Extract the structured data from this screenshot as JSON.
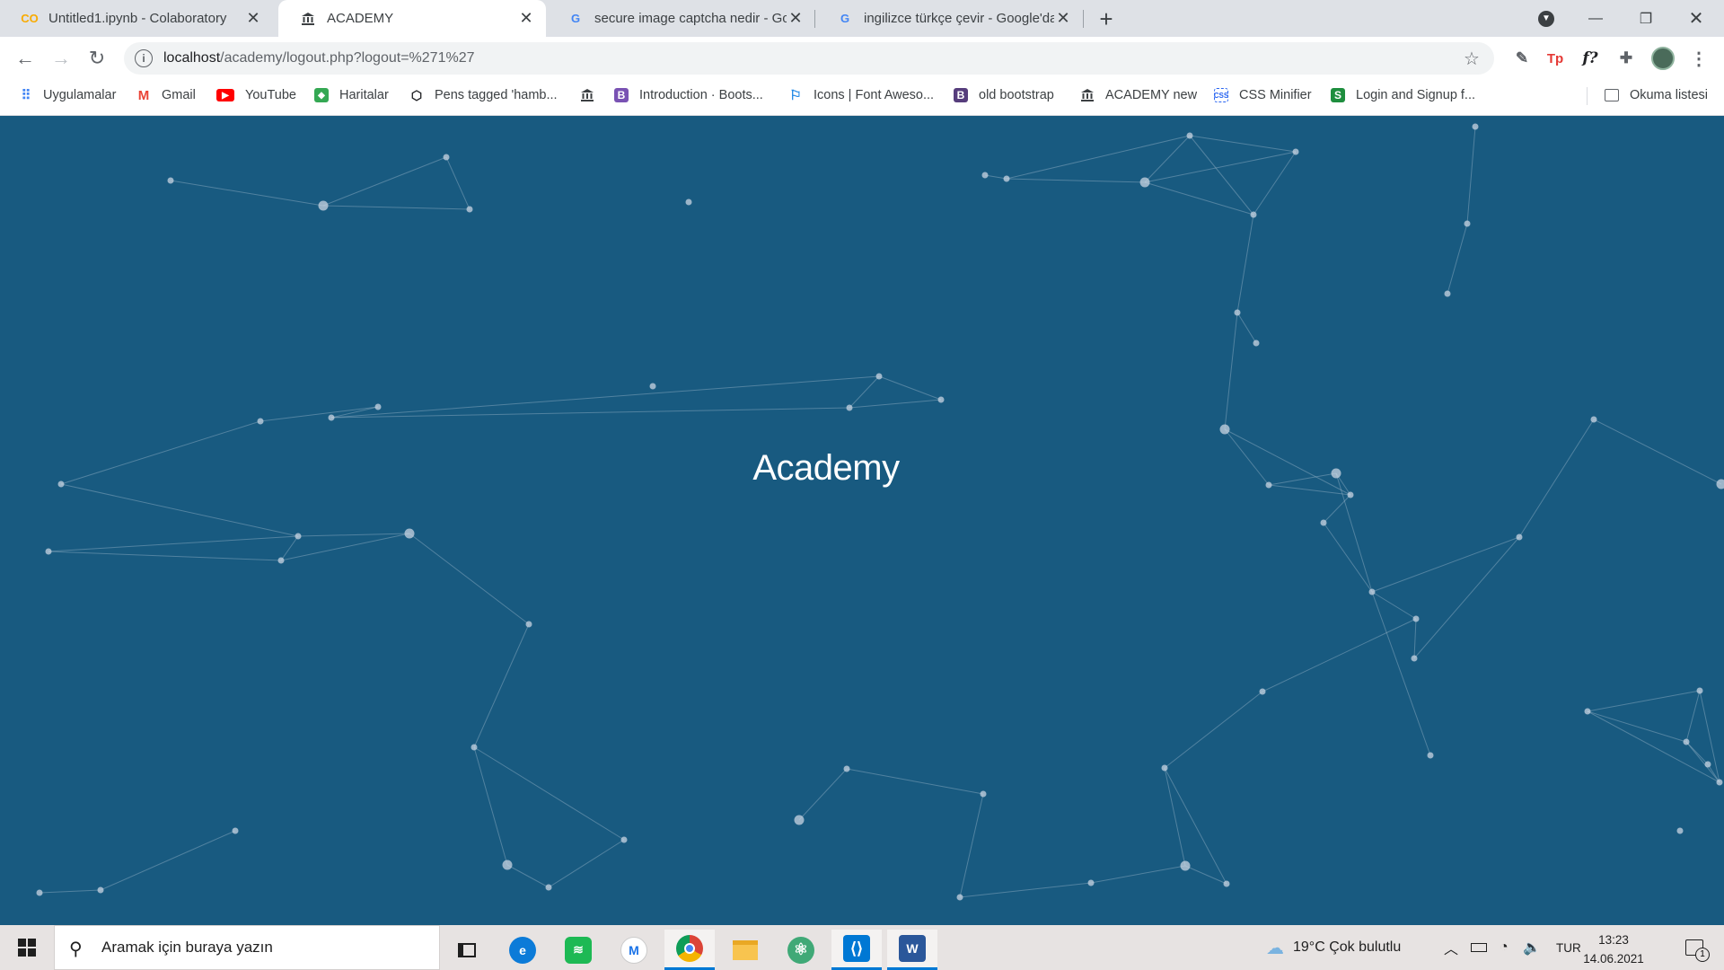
{
  "tabs": [
    {
      "title": "Untitled1.ipynb - Colaboratory",
      "favicon": "colab-icon",
      "active": false
    },
    {
      "title": "ACADEMY",
      "favicon": "academy-icon",
      "active": true
    },
    {
      "title": "secure image captcha nedir - Goo",
      "favicon": "google-icon",
      "active": false
    },
    {
      "title": "ingilizce türkçe çevir - Google'da",
      "favicon": "google-icon",
      "active": false
    }
  ],
  "toolbar": {
    "url_host": "localhost",
    "url_path": "/academy/logout.php?logout=%271%27"
  },
  "bookmarks": [
    {
      "label": "Uygulamalar",
      "icon": "apps-grid-icon"
    },
    {
      "label": "Gmail",
      "icon": "gmail-icon"
    },
    {
      "label": "YouTube",
      "icon": "youtube-icon"
    },
    {
      "label": "Haritalar",
      "icon": "maps-icon"
    },
    {
      "label": "Pens tagged 'hamb...",
      "icon": "codepen-icon"
    },
    {
      "label": "",
      "icon": "academy-icon"
    },
    {
      "label": "Introduction · Boots...",
      "icon": "bootstrap-icon"
    },
    {
      "label": "Icons | Font Aweso...",
      "icon": "flag-icon"
    },
    {
      "label": "old bootstrap",
      "icon": "bootstrap-icon"
    },
    {
      "label": "ACADEMY new",
      "icon": "academy-icon"
    },
    {
      "label": "CSS Minifier",
      "icon": "css-icon"
    },
    {
      "label": "Login and Signup f...",
      "icon": "s-icon"
    }
  ],
  "reading_list": "Okuma listesi",
  "page": {
    "brand": "Academy",
    "background_color": "#185a80"
  },
  "taskbar": {
    "search_placeholder": "Aramak için buraya yazın",
    "weather": "19°C  Çok bulutlu",
    "language": "TUR",
    "time": "13:23",
    "date": "14.06.2021",
    "notification_count": "1"
  }
}
